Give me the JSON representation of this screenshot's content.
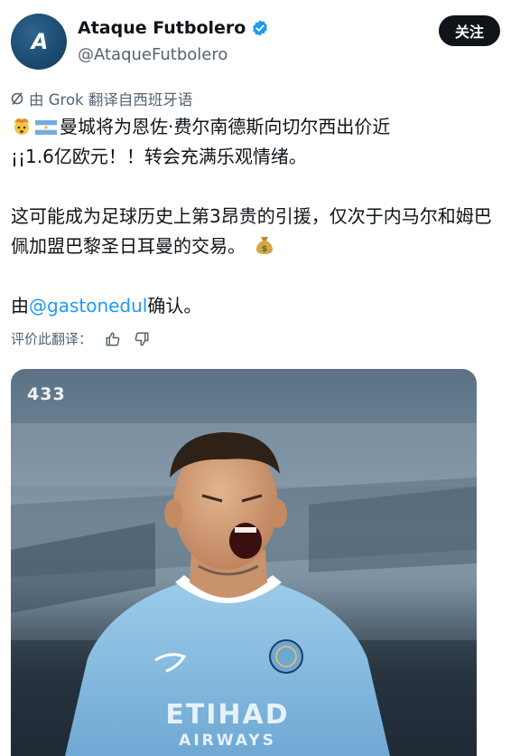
{
  "header": {
    "display_name": "Ataque Futbolero",
    "handle": "@AtaqueFutbolero",
    "follow_label": "关注",
    "avatar_text": "A",
    "verified_color": "#1d9bf0"
  },
  "translation": {
    "label": "由 Grok 翻译自西班牙语"
  },
  "tweet": {
    "line1": "曼城将为恩佐·费尔南德斯向切尔西出价近",
    "line2": "¡¡1.6亿欧元！！转会充满乐观情绪。",
    "para2": "这可能成为足球历史上第3昂贵的引援，仅次于内马尔和姆巴佩加盟巴黎圣日耳曼的交易。",
    "para3_prefix": "由",
    "mention": "@gastonedul",
    "para3_suffix": "确认。",
    "emojis": [
      "exploding-head-emoji",
      "argentina-flag-emoji",
      "money-bag-emoji"
    ]
  },
  "rate": {
    "label": "评价此翻译："
  },
  "media": {
    "watermark": "433",
    "shirt_sponsor_top": "ETIHAD",
    "shirt_sponsor_bottom": "AIRWAYS",
    "colors": {
      "shirt": "#8fc3e6",
      "background": "#6e8596"
    }
  }
}
